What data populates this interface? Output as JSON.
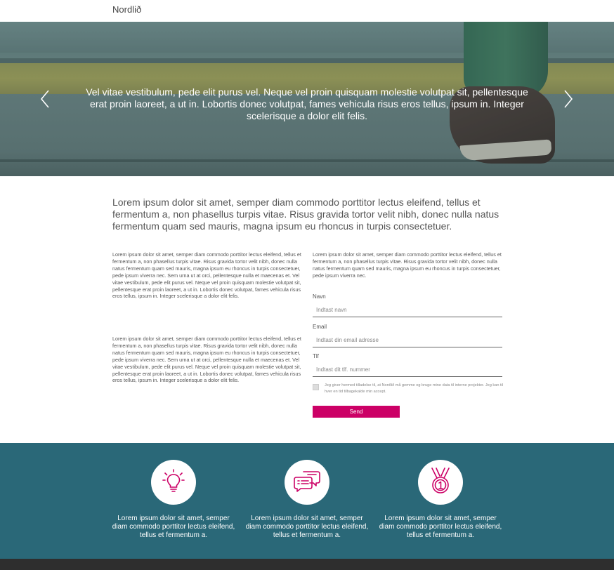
{
  "header": {
    "brand": "Nordlið"
  },
  "hero": {
    "caption": "Vel vitae vestibulum, pede elit purus vel. Neque vel proin quisquam molestie volutpat sit, pellentesque erat proin laoreet, a ut in. Lobortis donec volutpat, fames vehicula risus eros tellus, ipsum in. Integer scelerisque a dolor elit felis.",
    "prev_icon": "chevron-left-icon",
    "next_icon": "chevron-right-icon"
  },
  "intro": "Lorem ipsum dolor sit amet, semper diam commodo porttitor lectus eleifend, tellus et fermentum a, non phasellus turpis vitae. Risus gravida tortor velit nibh, donec nulla natus fermentum quam sed mauris, magna ipsum eu rhoncus in turpis consectetuer.",
  "left_column": {
    "para1": "Lorem ipsum dolor sit amet, semper diam commodo porttitor lectus eleifend, tellus et fermentum a, non phasellus turpis vitae. Risus gravida tortor velit nibh, donec nulla natus fermentum quam sed mauris, magna ipsum eu rhoncus in turpis consectetuer, pede ipsum viverra nec. Sem urna ut at orci, pellentesque nulla et maecenas et. Vel vitae vestibulum, pede elit purus vel. Neque vel proin quisquam molestie volutpat sit, pellentesque erat proin laoreet, a ut in. Lobortis donec volutpat, fames vehicula risus eros tellus, ipsum in. Integer scelerisque a dolor elit felis.",
    "para2": "Lorem ipsum dolor sit amet, semper diam commodo porttitor lectus eleifend, tellus et fermentum a, non phasellus turpis vitae. Risus gravida tortor velit nibh, donec nulla natus fermentum quam sed mauris, magna ipsum eu rhoncus in turpis consectetuer, pede ipsum viverra nec. Sem urna ut at orci, pellentesque nulla et maecenas et. Vel vitae vestibulum, pede elit purus vel. Neque vel proin quisquam molestie volutpat sit, pellentesque erat proin laoreet, a ut in. Lobortis donec volutpat, fames vehicula risus eros tellus, ipsum in. Integer scelerisque a dolor elit felis."
  },
  "form": {
    "intro": "Lorem ipsum dolor sit amet, semper diam commodo porttitor lectus eleifend, tellus et fermentum a, non phasellus turpis vitae. Risus gravida tortor velit nibh, donec nulla natus fermentum quam sed mauris, magna ipsum eu rhoncus in turpis consectetuer, pede ipsum viverra nec.",
    "name_label": "Navn",
    "name_placeholder": "Indtast navn",
    "email_label": "Email",
    "email_placeholder": "Indtast din email adresse",
    "phone_label": "Tlf",
    "phone_placeholder": "Indtast dit tlf. nummer",
    "consent": "Jeg giver hermed tilladelse til, at Nordlið må gemme og bruge mine data til interne projekter. Jeg kan til hver en tid tilbagekalde min accept.",
    "send_label": "Send"
  },
  "features": [
    {
      "icon": "lightbulb-icon",
      "text": "Lorem ipsum dolor sit amet, semper diam commodo porttitor lectus eleifend, tellus et fermentum a."
    },
    {
      "icon": "chat-bubbles-icon",
      "text": "Lorem ipsum dolor sit amet, semper diam commodo porttitor lectus eleifend, tellus et fermentum a."
    },
    {
      "icon": "medal-icon",
      "text": "Lorem ipsum dolor sit amet, semper diam commodo porttitor lectus eleifend, tellus et fermentum a."
    }
  ],
  "colors": {
    "accent": "#cc0066",
    "feature_bg": "#2a6878",
    "footer_bg": "#2e2e2e"
  }
}
